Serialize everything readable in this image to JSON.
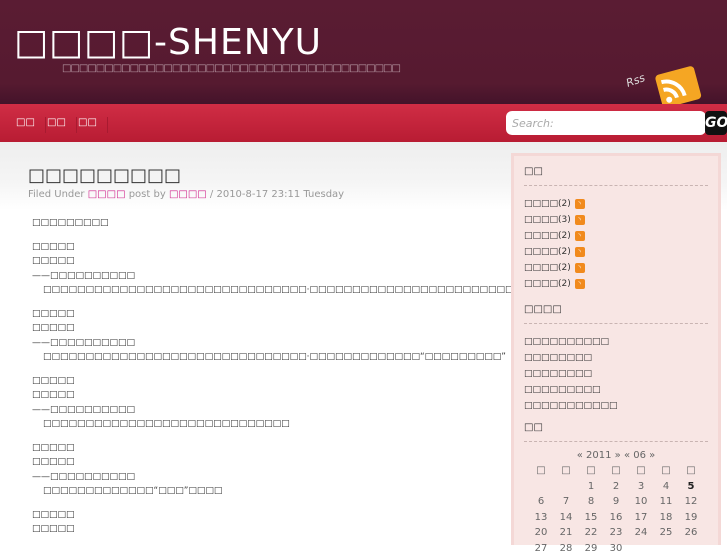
{
  "header": {
    "title": "□□□□-SHENYU",
    "tagline": "□□□□□□□□□□□□□□□□□□□□□□□□□□□□□□□□□□□□□□□□",
    "rss_label": "Rss"
  },
  "nav": {
    "items": [
      "□□",
      "□□",
      "□□"
    ]
  },
  "search": {
    "placeholder": "Search:",
    "go": "GO"
  },
  "post": {
    "title": "□□□□□□□□□",
    "filed_under": "Filed Under",
    "category": "□□□□",
    "post_by": "post by",
    "author": "□□□□",
    "date": "/ 2010-8-17 23:11 Tuesday",
    "intro": "□□□□□□□□□",
    "stanzas": [
      {
        "l1": "□□□□□",
        "l2": "□□□□□",
        "l3": "——□□□□□□□□□□",
        "l4": "□□□□□□□□□□□□□□□□□□□□□□□□□□□□□□□·□□□□□□□□□□□□□□□□□□□□□□□□□□□"
      },
      {
        "l1": "□□□□□",
        "l2": "□□□□□",
        "l3": "——□□□□□□□□□□",
        "l4": "□□□□□□□□□□□□□□□□□□□□□□□□□□□□□□□·□□□□□□□□□□□□□“□□□□□□□□□”"
      },
      {
        "l1": "□□□□□",
        "l2": "□□□□□",
        "l3": "——□□□□□□□□□□",
        "l4": "□□□□□□□□□□□□□□□□□□□□□□□□□□□□□"
      },
      {
        "l1": "□□□□□",
        "l2": "□□□□□",
        "l3": "——□□□□□□□□□□",
        "l4": "□□□□□□□□□□□□□“□□□”□□□□"
      },
      {
        "l1": "□□□□□",
        "l2": "□□□□□"
      }
    ]
  },
  "sidebar": {
    "categories_title": "□□",
    "categories": [
      {
        "name": "□□□□",
        "count": "(2)"
      },
      {
        "name": "□□□□",
        "count": "(3)"
      },
      {
        "name": "□□□□",
        "count": "(2)"
      },
      {
        "name": "□□□□",
        "count": "(2)"
      },
      {
        "name": "□□□□",
        "count": "(2)"
      },
      {
        "name": "□□□□",
        "count": "(2)"
      }
    ],
    "links_title": "□□□□",
    "links": [
      "□□□□□□□□□□",
      "□□□□□□□□",
      "□□□□□□□□",
      "□□□□□□□□□",
      "□□□□□□□□□□□"
    ],
    "calendar_title": "□□",
    "calendar_nav": "« 2011 » « 06 »",
    "weekdays": [
      "□",
      "□",
      "□",
      "□",
      "□",
      "□",
      "□"
    ],
    "weeks": [
      [
        "",
        "",
        "1",
        "2",
        "3",
        "4",
        "5"
      ],
      [
        "6",
        "7",
        "8",
        "9",
        "10",
        "11",
        "12"
      ],
      [
        "13",
        "14",
        "15",
        "16",
        "17",
        "18",
        "19"
      ],
      [
        "20",
        "21",
        "22",
        "23",
        "24",
        "25",
        "26"
      ],
      [
        "27",
        "28",
        "29",
        "30",
        "",
        "",
        ""
      ]
    ]
  }
}
